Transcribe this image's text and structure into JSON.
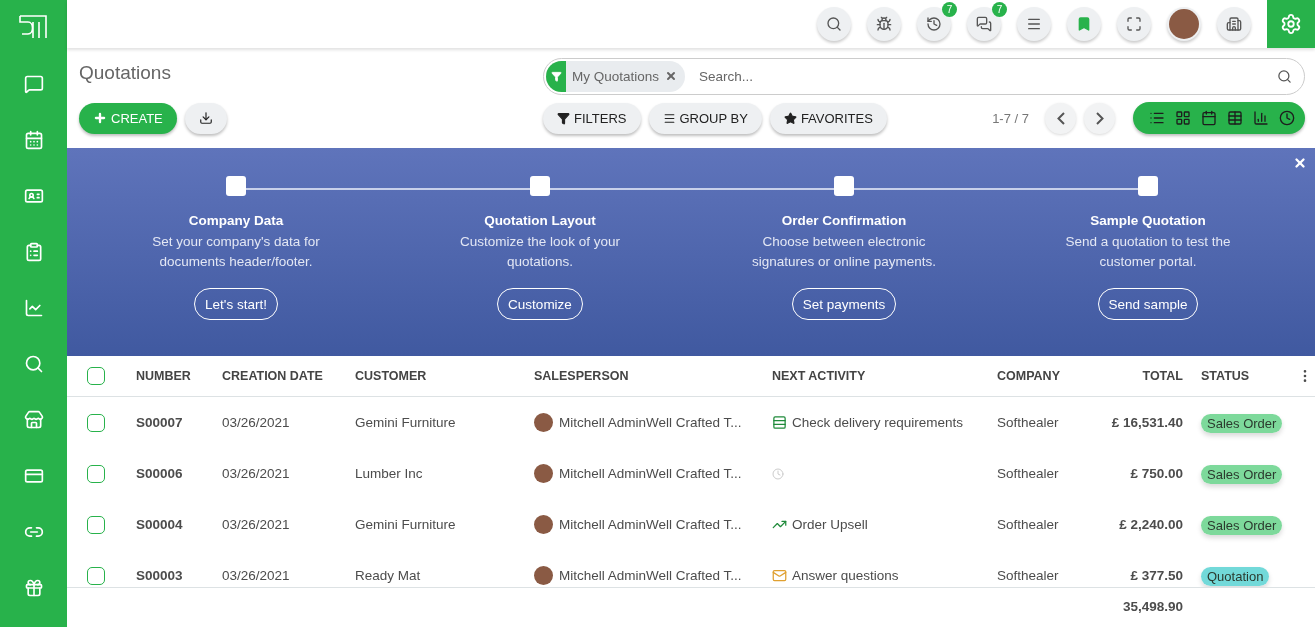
{
  "sidebar": {
    "items": [
      {
        "kind": "chat"
      },
      {
        "kind": "calendar"
      },
      {
        "kind": "contacts"
      },
      {
        "kind": "notes"
      },
      {
        "kind": "chart"
      },
      {
        "kind": "search"
      },
      {
        "kind": "store"
      },
      {
        "kind": "card"
      },
      {
        "kind": "link"
      },
      {
        "kind": "gift"
      }
    ]
  },
  "systray": [
    {
      "kind": "search"
    },
    {
      "kind": "bug"
    },
    {
      "kind": "activity",
      "badge": "7"
    },
    {
      "kind": "messages",
      "badge": "7"
    },
    {
      "kind": "menu"
    },
    {
      "kind": "bookmark"
    },
    {
      "kind": "fullscreen"
    },
    {
      "kind": "avatar"
    },
    {
      "kind": "company"
    },
    {
      "kind": "settings"
    }
  ],
  "title": "Quotations",
  "search": {
    "facet": "My Quotations",
    "placeholder": "Search..."
  },
  "create_button": "CREATE",
  "filter_buttons": [
    {
      "kind": "filter",
      "label": "FILTERS"
    },
    {
      "kind": "group",
      "label": "GROUP BY"
    },
    {
      "kind": "star",
      "label": "FAVORITES"
    }
  ],
  "pager": "1-7 / 7",
  "views": [
    {
      "kind": "list"
    },
    {
      "kind": "kanban"
    },
    {
      "kind": "calendar"
    },
    {
      "kind": "pivot"
    },
    {
      "kind": "graph"
    },
    {
      "kind": "activity"
    }
  ],
  "banner": {
    "steps": [
      {
        "title": "Company Data",
        "text": "Set your company's data for documents header/footer.",
        "button": "Let's start!"
      },
      {
        "title": "Quotation Layout",
        "text": "Customize the look of your quotations.",
        "button": "Customize"
      },
      {
        "title": "Order Confirmation",
        "text": "Choose between electronic signatures or online payments.",
        "button": "Set payments"
      },
      {
        "title": "Sample Quotation",
        "text": "Send a quotation to test the customer portal.",
        "button": "Send sample"
      }
    ]
  },
  "table": {
    "header_checked": false,
    "columns": [
      "NUMBER",
      "CREATION DATE",
      "CUSTOMER",
      "SALESPERSON",
      "NEXT ACTIVITY",
      "COMPANY",
      "TOTAL",
      "STATUS"
    ],
    "rows": [
      {
        "checked": false,
        "number": "S00007",
        "date": "03/26/2021",
        "customer": "Gemini Furniture",
        "salesperson": "Mitchell AdminWell Crafted T...",
        "activity": {
          "kind": "tasks",
          "label": "Check delivery requirements"
        },
        "company": "Softhealer",
        "total": "£ 16,531.40",
        "status": {
          "label": "Sales Order",
          "color": "#7dd99b"
        }
      },
      {
        "checked": false,
        "number": "S00006",
        "date": "03/26/2021",
        "customer": "Lumber Inc",
        "salesperson": "Mitchell AdminWell Crafted T...",
        "activity": {
          "kind": "none"
        },
        "company": "Softhealer",
        "total": "£ 750.00",
        "status": {
          "label": "Sales Order",
          "color": "#7dd99b"
        }
      },
      {
        "checked": false,
        "number": "S00004",
        "date": "03/26/2021",
        "customer": "Gemini Furniture",
        "salesperson": "Mitchell AdminWell Crafted T...",
        "activity": {
          "kind": "upsell",
          "label": "Order Upsell"
        },
        "company": "Softhealer",
        "total": "£ 2,240.00",
        "status": {
          "label": "Sales Order",
          "color": "#7dd99b"
        }
      },
      {
        "checked": false,
        "number": "S00003",
        "date": "03/26/2021",
        "customer": "Ready Mat",
        "salesperson": "Mitchell AdminWell Crafted T...",
        "activity": {
          "kind": "email",
          "label": "Answer questions"
        },
        "company": "Softhealer",
        "total": "£ 377.50",
        "status": {
          "label": "Quotation",
          "color": "#72d9d9"
        }
      }
    ],
    "sum": "35,498.90"
  }
}
